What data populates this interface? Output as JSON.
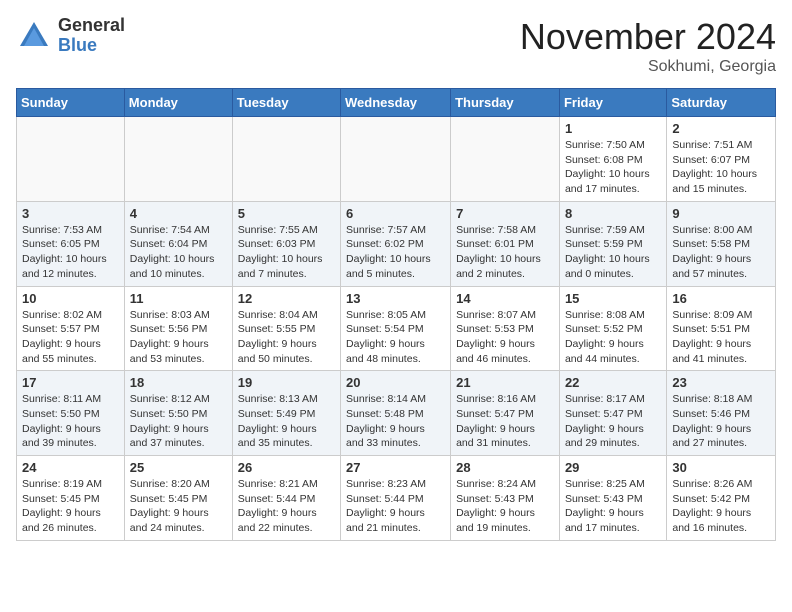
{
  "logo": {
    "general": "General",
    "blue": "Blue"
  },
  "title": "November 2024",
  "location": "Sokhumi, Georgia",
  "days_header": [
    "Sunday",
    "Monday",
    "Tuesday",
    "Wednesday",
    "Thursday",
    "Friday",
    "Saturday"
  ],
  "weeks": [
    [
      {
        "day": "",
        "info": ""
      },
      {
        "day": "",
        "info": ""
      },
      {
        "day": "",
        "info": ""
      },
      {
        "day": "",
        "info": ""
      },
      {
        "day": "",
        "info": ""
      },
      {
        "day": "1",
        "info": "Sunrise: 7:50 AM\nSunset: 6:08 PM\nDaylight: 10 hours and 17 minutes."
      },
      {
        "day": "2",
        "info": "Sunrise: 7:51 AM\nSunset: 6:07 PM\nDaylight: 10 hours and 15 minutes."
      }
    ],
    [
      {
        "day": "3",
        "info": "Sunrise: 7:53 AM\nSunset: 6:05 PM\nDaylight: 10 hours and 12 minutes."
      },
      {
        "day": "4",
        "info": "Sunrise: 7:54 AM\nSunset: 6:04 PM\nDaylight: 10 hours and 10 minutes."
      },
      {
        "day": "5",
        "info": "Sunrise: 7:55 AM\nSunset: 6:03 PM\nDaylight: 10 hours and 7 minutes."
      },
      {
        "day": "6",
        "info": "Sunrise: 7:57 AM\nSunset: 6:02 PM\nDaylight: 10 hours and 5 minutes."
      },
      {
        "day": "7",
        "info": "Sunrise: 7:58 AM\nSunset: 6:01 PM\nDaylight: 10 hours and 2 minutes."
      },
      {
        "day": "8",
        "info": "Sunrise: 7:59 AM\nSunset: 5:59 PM\nDaylight: 10 hours and 0 minutes."
      },
      {
        "day": "9",
        "info": "Sunrise: 8:00 AM\nSunset: 5:58 PM\nDaylight: 9 hours and 57 minutes."
      }
    ],
    [
      {
        "day": "10",
        "info": "Sunrise: 8:02 AM\nSunset: 5:57 PM\nDaylight: 9 hours and 55 minutes."
      },
      {
        "day": "11",
        "info": "Sunrise: 8:03 AM\nSunset: 5:56 PM\nDaylight: 9 hours and 53 minutes."
      },
      {
        "day": "12",
        "info": "Sunrise: 8:04 AM\nSunset: 5:55 PM\nDaylight: 9 hours and 50 minutes."
      },
      {
        "day": "13",
        "info": "Sunrise: 8:05 AM\nSunset: 5:54 PM\nDaylight: 9 hours and 48 minutes."
      },
      {
        "day": "14",
        "info": "Sunrise: 8:07 AM\nSunset: 5:53 PM\nDaylight: 9 hours and 46 minutes."
      },
      {
        "day": "15",
        "info": "Sunrise: 8:08 AM\nSunset: 5:52 PM\nDaylight: 9 hours and 44 minutes."
      },
      {
        "day": "16",
        "info": "Sunrise: 8:09 AM\nSunset: 5:51 PM\nDaylight: 9 hours and 41 minutes."
      }
    ],
    [
      {
        "day": "17",
        "info": "Sunrise: 8:11 AM\nSunset: 5:50 PM\nDaylight: 9 hours and 39 minutes."
      },
      {
        "day": "18",
        "info": "Sunrise: 8:12 AM\nSunset: 5:50 PM\nDaylight: 9 hours and 37 minutes."
      },
      {
        "day": "19",
        "info": "Sunrise: 8:13 AM\nSunset: 5:49 PM\nDaylight: 9 hours and 35 minutes."
      },
      {
        "day": "20",
        "info": "Sunrise: 8:14 AM\nSunset: 5:48 PM\nDaylight: 9 hours and 33 minutes."
      },
      {
        "day": "21",
        "info": "Sunrise: 8:16 AM\nSunset: 5:47 PM\nDaylight: 9 hours and 31 minutes."
      },
      {
        "day": "22",
        "info": "Sunrise: 8:17 AM\nSunset: 5:47 PM\nDaylight: 9 hours and 29 minutes."
      },
      {
        "day": "23",
        "info": "Sunrise: 8:18 AM\nSunset: 5:46 PM\nDaylight: 9 hours and 27 minutes."
      }
    ],
    [
      {
        "day": "24",
        "info": "Sunrise: 8:19 AM\nSunset: 5:45 PM\nDaylight: 9 hours and 26 minutes."
      },
      {
        "day": "25",
        "info": "Sunrise: 8:20 AM\nSunset: 5:45 PM\nDaylight: 9 hours and 24 minutes."
      },
      {
        "day": "26",
        "info": "Sunrise: 8:21 AM\nSunset: 5:44 PM\nDaylight: 9 hours and 22 minutes."
      },
      {
        "day": "27",
        "info": "Sunrise: 8:23 AM\nSunset: 5:44 PM\nDaylight: 9 hours and 21 minutes."
      },
      {
        "day": "28",
        "info": "Sunrise: 8:24 AM\nSunset: 5:43 PM\nDaylight: 9 hours and 19 minutes."
      },
      {
        "day": "29",
        "info": "Sunrise: 8:25 AM\nSunset: 5:43 PM\nDaylight: 9 hours and 17 minutes."
      },
      {
        "day": "30",
        "info": "Sunrise: 8:26 AM\nSunset: 5:42 PM\nDaylight: 9 hours and 16 minutes."
      }
    ]
  ]
}
